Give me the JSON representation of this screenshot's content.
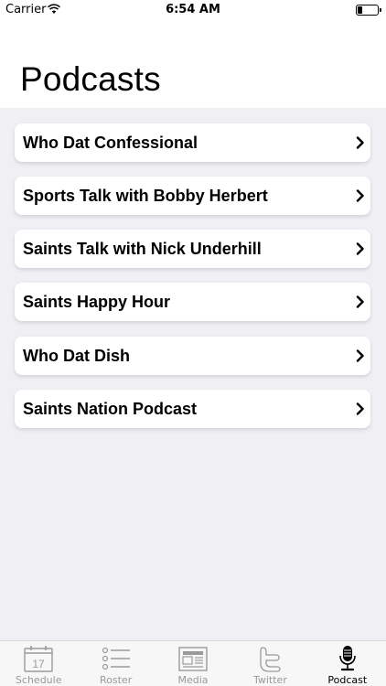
{
  "status_bar": {
    "carrier": "Carrier",
    "time": "6:54 AM"
  },
  "page": {
    "title": "Podcasts"
  },
  "podcasts": [
    {
      "label": "Who Dat Confessional"
    },
    {
      "label": "Sports Talk with Bobby Herbert"
    },
    {
      "label": "Saints Talk with Nick Underhill"
    },
    {
      "label": "Saints Happy Hour"
    },
    {
      "label": "Who Dat Dish"
    },
    {
      "label": "Saints Nation Podcast"
    }
  ],
  "tab_bar": {
    "active_color": "#000000",
    "inactive_color": "#9a9a9a",
    "tabs": [
      {
        "label": "Schedule",
        "icon": "calendar-icon",
        "calendar_day": "17",
        "active": false
      },
      {
        "label": "Roster",
        "icon": "list-icon",
        "active": false
      },
      {
        "label": "Media",
        "icon": "newspaper-icon",
        "active": false
      },
      {
        "label": "Twitter",
        "icon": "twitter-icon",
        "active": false
      },
      {
        "label": "Podcast",
        "icon": "microphone-icon",
        "active": true
      }
    ]
  }
}
